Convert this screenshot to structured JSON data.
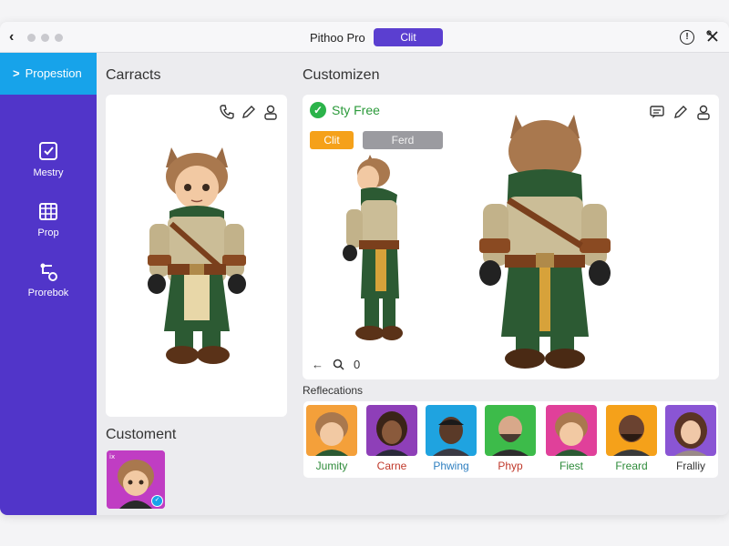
{
  "titlebar": {
    "app_title": "Pithoo Pro",
    "pill_label": "Clit",
    "back_icon": "chevron-left-icon",
    "info_icon": "info-icon",
    "tools_icon": "tools-icon"
  },
  "sidebar": {
    "bg_color": "#5135c9",
    "active_color": "#17a3ea",
    "active_label": "Propestion",
    "items": [
      {
        "label": "Mestry",
        "icon": "checkbox-icon"
      },
      {
        "label": "Prop",
        "icon": "calendar-grid-icon"
      },
      {
        "label": "Prorebok",
        "icon": "route-icon"
      }
    ]
  },
  "left_panel": {
    "title": "Carracts",
    "icons": [
      "phone-icon",
      "pencil-icon",
      "user-icon"
    ]
  },
  "customization_panel": {
    "title": "Customizen",
    "status": "Sty Free",
    "buttons": {
      "orange": "Clit",
      "gray": "Ferd"
    },
    "icons": [
      "comment-icon",
      "pencil-icon",
      "user-icon"
    ],
    "zoom_value": "0"
  },
  "references": {
    "title": "Reflecations",
    "items": [
      {
        "name": "Jumity",
        "bg": "#f4a03a",
        "name_color": "#2e8b3a"
      },
      {
        "name": "Carne",
        "bg": "#8e3fb8",
        "name_color": "#c0392b"
      },
      {
        "name": "Phwing",
        "bg": "#1fa3e0",
        "name_color": "#2e7fc0"
      },
      {
        "name": "Phyp",
        "bg": "#3dbb4a",
        "name_color": "#c0392b"
      },
      {
        "name": "Fiest",
        "bg": "#e0409a",
        "name_color": "#2e8b3a"
      },
      {
        "name": "Freard",
        "bg": "#f5a11a",
        "name_color": "#2e8b3a"
      },
      {
        "name": "Fralliy",
        "bg": "#8a55d4",
        "name_color": "#333333"
      }
    ]
  },
  "customent": {
    "title": "Customent"
  }
}
